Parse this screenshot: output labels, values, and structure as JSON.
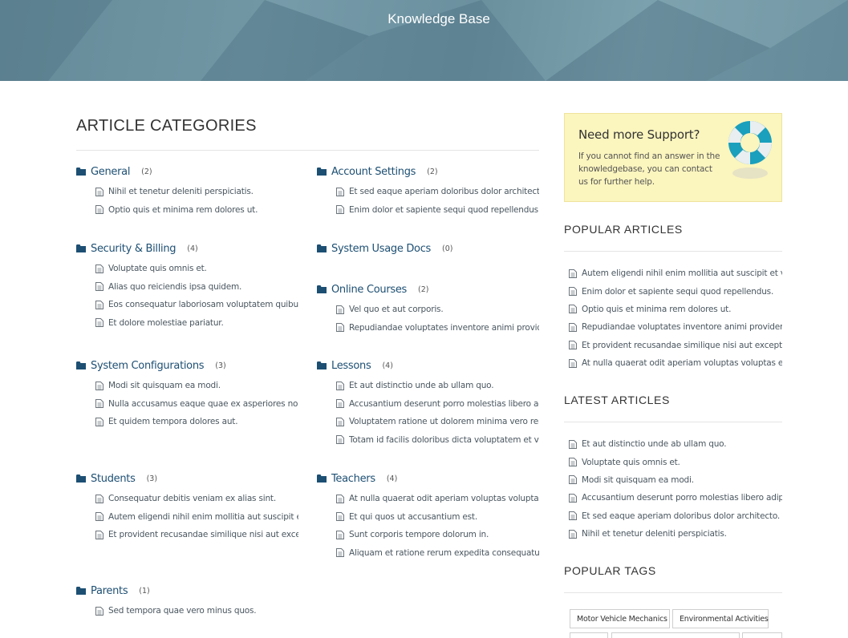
{
  "header": {
    "title": "Knowledge Base"
  },
  "main": {
    "title": "ARTICLE CATEGORIES",
    "categories": [
      {
        "name": "General",
        "count": "(2)",
        "articles": [
          "Nihil et tenetur deleniti perspiciatis.",
          "Optio quis et minima rem dolores ut."
        ]
      },
      {
        "name": "Account Settings",
        "count": "(2)",
        "articles": [
          "Et sed eaque aperiam doloribus dolor architecto.",
          "Enim dolor et sapiente sequi quod repellendus."
        ]
      },
      {
        "name": "Security & Billing",
        "count": "(4)",
        "articles": [
          "Voluptate quis omnis et.",
          "Alias quo reiciendis ipsa quidem.",
          "Eos consequatur laboriosam voluptatem quibusdam.",
          "Et dolore molestiae pariatur."
        ]
      },
      {
        "name": "System Usage Docs",
        "count": "(0)",
        "articles": []
      },
      {
        "name": "Online Courses",
        "count": "(2)",
        "articles": [
          "Vel quo et aut corporis.",
          "Repudiandae voluptates inventore animi provident."
        ]
      },
      {
        "name": "System Configurations",
        "count": "(3)",
        "articles": [
          "Modi sit quisquam ea modi.",
          "Nulla accusamus eaque quae ex asperiores non sit.",
          "Et quidem tempora dolores aut."
        ]
      },
      {
        "name": "Lessons",
        "count": "(4)",
        "articles": [
          "Et aut distinctio unde ab ullam quo.",
          "Accusantium deserunt porro molestias libero adipisci.",
          "Voluptatem ratione ut dolorem minima vero rem.",
          "Totam id facilis doloribus dicta voluptatem et voluptas."
        ]
      },
      {
        "name": "Students",
        "count": "(3)",
        "articles": [
          "Consequatur debitis veniam ex alias sint.",
          "Autem eligendi nihil enim mollitia aut suscipit et velit.",
          "Et provident recusandae similique nisi aut excepturi."
        ]
      },
      {
        "name": "Teachers",
        "count": "(4)",
        "articles": [
          "At nulla quaerat odit aperiam voluptas voluptas eligendi.",
          "Et qui quos ut accusantium est.",
          "Sunt corporis tempore dolorum in.",
          "Aliquam et ratione rerum expedita consequatur."
        ]
      },
      {
        "name": "Parents",
        "count": "(1)",
        "articles": [
          "Sed tempora quae vero minus quos."
        ]
      }
    ]
  },
  "sidebar": {
    "support": {
      "title": "Need more Support?",
      "text": "If you cannot find an answer in the knowledgebase, you can contact us for further help."
    },
    "popular": {
      "title": "POPULAR ARTICLES",
      "items": [
        "Autem eligendi nihil enim mollitia aut suscipit et velit.",
        "Enim dolor et sapiente sequi quod repellendus.",
        "Optio quis et minima rem dolores ut.",
        "Repudiandae voluptates inventore animi provident.",
        "Et provident recusandae similique nisi aut excepturi.",
        "At nulla quaerat odit aperiam voluptas voluptas eligendi."
      ]
    },
    "latest": {
      "title": "LATEST ARTICLES",
      "items": [
        "Et aut distinctio unde ab ullam quo.",
        "Voluptate quis omnis et.",
        "Modi sit quisquam ea modi.",
        "Accusantium deserunt porro molestias libero adipisci.",
        "Et sed eaque aperiam doloribus dolor architecto.",
        "Nihil et tenetur deleniti perspiciatis."
      ]
    },
    "tags": {
      "title": "POPULAR TAGS",
      "items": [
        "Motor Vehicle Mechanics",
        "Environmental Activities"
      ]
    }
  },
  "colors": {
    "link": "#1d4f73",
    "support_bg": "#fbf5be",
    "hero": "#6a8f9d"
  },
  "icons": {
    "category": "folder-icon",
    "article": "document-icon",
    "support": "lifebuoy-icon"
  }
}
